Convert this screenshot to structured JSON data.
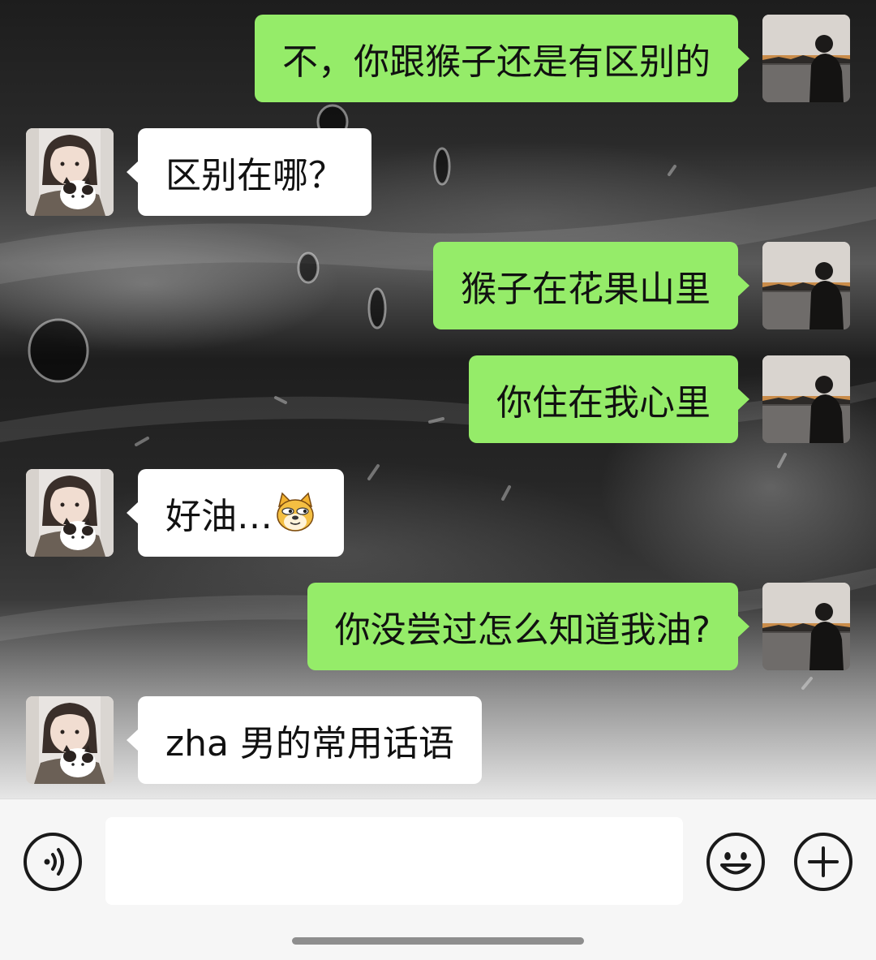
{
  "chat": {
    "messages": [
      {
        "direction": "sent",
        "text": "不，你跟猴子还是有区别的"
      },
      {
        "direction": "received",
        "text": "区别在哪？"
      },
      {
        "direction": "sent",
        "text": "猴子在花果山里"
      },
      {
        "direction": "sent",
        "text": "你住在我心里"
      },
      {
        "direction": "received",
        "text": "好油…",
        "emoji": "doge-emoji"
      },
      {
        "direction": "sent",
        "text": "你没尝过怎么知道我油?"
      },
      {
        "direction": "received",
        "text": "zha 男的常用话语"
      }
    ],
    "avatars": {
      "sent": "avatar-man-sunset",
      "received": "avatar-girl-with-cat"
    }
  },
  "input_bar": {
    "value": "",
    "icons": {
      "voice": "voice-icon",
      "emoji": "emoji-icon",
      "more": "plus-icon"
    }
  },
  "colors": {
    "sent_bubble": "#95ec69",
    "received_bubble": "#ffffff",
    "input_bar_bg": "#f6f6f6"
  }
}
